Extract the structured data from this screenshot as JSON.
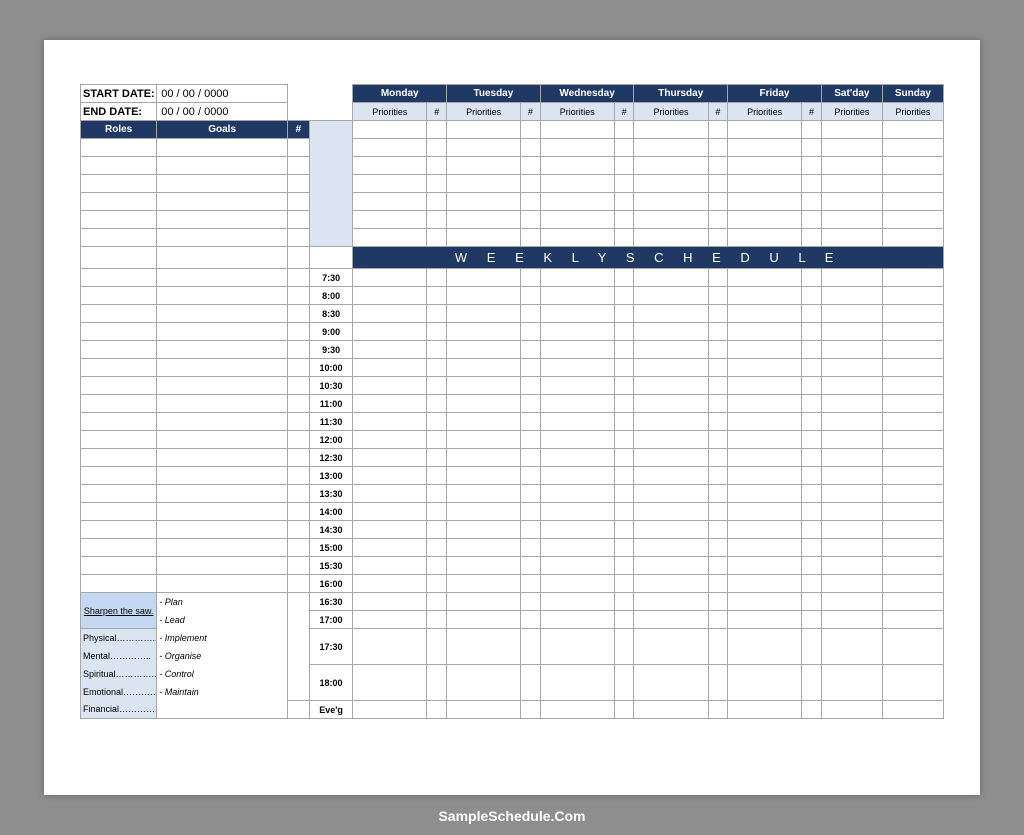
{
  "labels": {
    "start_date": "START DATE:",
    "end_date": "END DATE:"
  },
  "values": {
    "start_date": "00 / 00 / 0000",
    "end_date": "00 / 00 / 0000"
  },
  "headers": {
    "roles": "Roles",
    "goals": "Goals",
    "num": "#",
    "priorities": "Priorities",
    "hash": "#"
  },
  "days": [
    "Monday",
    "Tuesday",
    "Wednesday",
    "Thursday",
    "Friday",
    "Sat'day",
    "Sunday"
  ],
  "banner": "W E E K L Y       S C H E D U L E",
  "times": [
    "7:30",
    "8:00",
    "8:30",
    "9:00",
    "9:30",
    "10:00",
    "10:30",
    "11:00",
    "11:30",
    "12:00",
    "12:30",
    "13:00",
    "13:30",
    "14:00",
    "14:30",
    "15:00",
    "15:30",
    "16:00",
    "16:30",
    "17:00",
    "17:30",
    "18:00",
    "Eve'g"
  ],
  "sharpen": {
    "title": "Sharpen the saw.",
    "dims": [
      "Physical…………..",
      "Mental…………..",
      "Spiritual…………..",
      "Emotional…………",
      "Financial………….."
    ],
    "verbs": [
      "-  Plan",
      "-  Lead",
      "-  Implement",
      "-  Organise",
      "-  Control",
      "-  Maintain"
    ]
  },
  "watermark": "SampleSchedule.Com"
}
